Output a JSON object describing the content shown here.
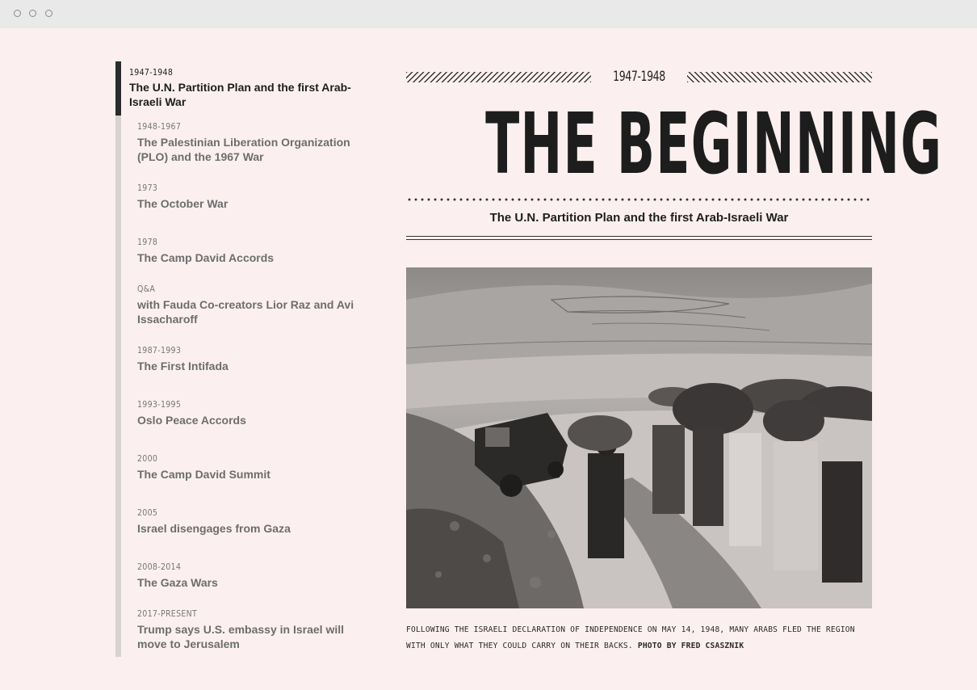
{
  "timeline": [
    {
      "date": "1947-1948",
      "title": "The U.N. Partition Plan and the first Arab-Israeli War",
      "active": true
    },
    {
      "date": "1948-1967",
      "title": "The Palestinian Liberation Organization (PLO) and the 1967 War"
    },
    {
      "date": "1973",
      "title": "The October War"
    },
    {
      "date": "1978",
      "title": "The Camp David Accords"
    },
    {
      "date": "Q&A",
      "title": "with Fauda Co-creators Lior Raz and Avi Issacharoff"
    },
    {
      "date": "1987-1993",
      "title": "The First Intifada"
    },
    {
      "date": "1993-1995",
      "title": "Oslo Peace Accords"
    },
    {
      "date": "2000",
      "title": "The Camp David Summit"
    },
    {
      "date": "2005",
      "title": "Israel disengages from Gaza"
    },
    {
      "date": "2008-2014",
      "title": "The Gaza Wars"
    },
    {
      "date": "2017-PRESENT",
      "title": "Trump says U.S. embassy in Israel will move to Jerusalem"
    }
  ],
  "article": {
    "era": "1947-1948",
    "headline": "THE BEGINNING",
    "subtitle": "The U.N. Partition Plan and the first Arab-Israeli War",
    "caption": "Following the Israeli declaration of independence on May 14, 1948, many Arabs fled the region with only what they could carry on their backs.",
    "credit": "Photo by Fred Csasznik"
  },
  "colors": {
    "background": "#fbf0ef",
    "active_bar": "#2b2b2b",
    "inactive_bar": "#d6d2d2",
    "text": "#1e1e1e"
  }
}
